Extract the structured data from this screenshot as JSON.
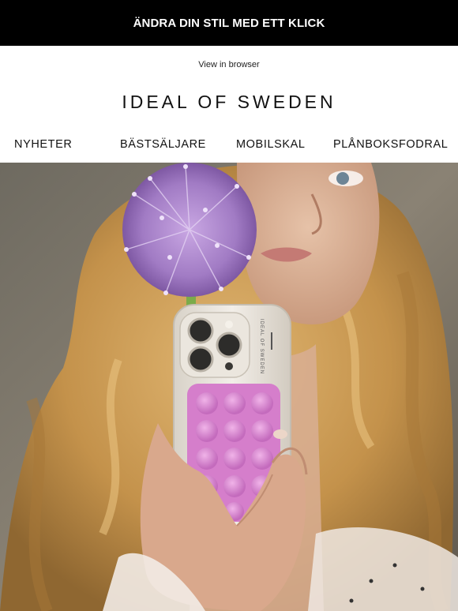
{
  "banner": {
    "text": "ÄNDRA DIN STIL MED ETT KLICK"
  },
  "header": {
    "view_in_browser": "View in browser",
    "logo": "IDEAL OF SWEDEN"
  },
  "nav": {
    "items": [
      {
        "label": "NYHETER"
      },
      {
        "label": "BÄSTSÄLJARE"
      },
      {
        "label": "MOBILSKAL"
      },
      {
        "label": "PLÅNBOKSFODRAL"
      }
    ]
  },
  "hero": {
    "case_print": "IDEAL OF SWEDEN",
    "colors": {
      "background": "#7b7568",
      "hair": "#c79a55",
      "allium": "#a77fc8",
      "phone_case": "#e9e4dc",
      "suction_pad": "#d57ecb"
    }
  }
}
